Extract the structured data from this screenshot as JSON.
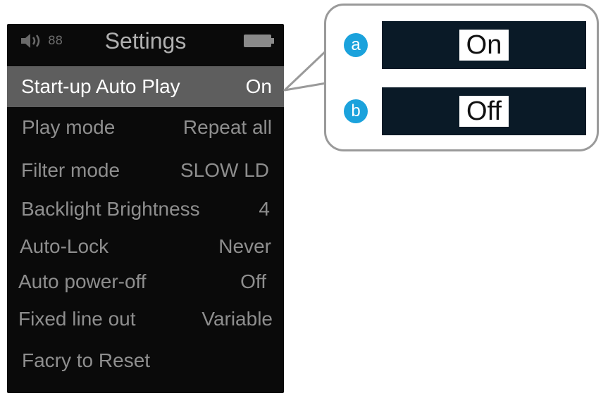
{
  "device": {
    "title": "Settings",
    "volume_level": "88",
    "battery": "full"
  },
  "menu": {
    "items": [
      {
        "label": "Start-up Auto Play",
        "value": "On",
        "selected": true
      },
      {
        "label": "Play mode",
        "value": "Repeat all"
      },
      {
        "label": "Filter mode",
        "value": "SLOW LD"
      },
      {
        "label": "Backlight Brightness",
        "value": "4"
      },
      {
        "label": "Auto-Lock",
        "value": "Never"
      },
      {
        "label": "Auto power-off",
        "value": "Off"
      },
      {
        "label": "Fixed line out",
        "value": "Variable"
      },
      {
        "label": "Facry to Reset",
        "value": ""
      }
    ]
  },
  "callout": {
    "options": [
      {
        "badge": "a",
        "text": "On"
      },
      {
        "badge": "b",
        "text": "Off"
      }
    ]
  },
  "colors": {
    "screen_bg": "#0a0a0a",
    "selected_row": "#5e5e5e",
    "badge": "#1ba2dc",
    "option_box": "#0a1a27"
  },
  "icons": [
    "speaker-icon",
    "battery-icon"
  ]
}
